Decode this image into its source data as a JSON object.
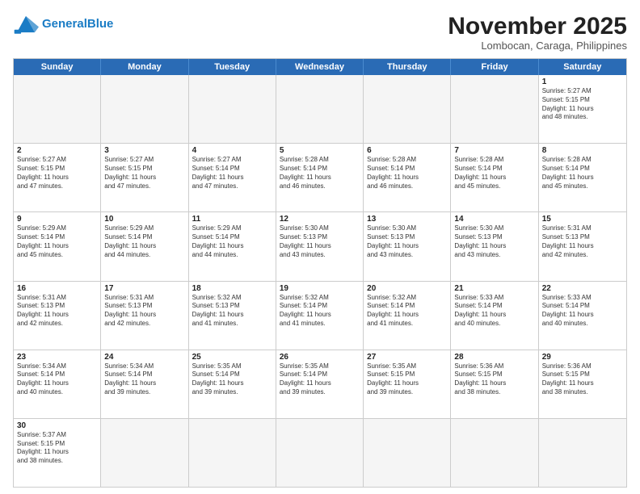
{
  "header": {
    "logo_general": "General",
    "logo_blue": "Blue",
    "month_title": "November 2025",
    "location": "Lombocan, Caraga, Philippines"
  },
  "days_of_week": [
    "Sunday",
    "Monday",
    "Tuesday",
    "Wednesday",
    "Thursday",
    "Friday",
    "Saturday"
  ],
  "rows": [
    [
      {
        "day": "",
        "text": "",
        "empty": true
      },
      {
        "day": "",
        "text": "",
        "empty": true
      },
      {
        "day": "",
        "text": "",
        "empty": true
      },
      {
        "day": "",
        "text": "",
        "empty": true
      },
      {
        "day": "",
        "text": "",
        "empty": true
      },
      {
        "day": "",
        "text": "",
        "empty": true
      },
      {
        "day": "1",
        "text": "Sunrise: 5:27 AM\nSunset: 5:15 PM\nDaylight: 11 hours\nand 48 minutes.",
        "empty": false
      }
    ],
    [
      {
        "day": "2",
        "text": "Sunrise: 5:27 AM\nSunset: 5:15 PM\nDaylight: 11 hours\nand 47 minutes.",
        "empty": false
      },
      {
        "day": "3",
        "text": "Sunrise: 5:27 AM\nSunset: 5:15 PM\nDaylight: 11 hours\nand 47 minutes.",
        "empty": false
      },
      {
        "day": "4",
        "text": "Sunrise: 5:27 AM\nSunset: 5:14 PM\nDaylight: 11 hours\nand 47 minutes.",
        "empty": false
      },
      {
        "day": "5",
        "text": "Sunrise: 5:28 AM\nSunset: 5:14 PM\nDaylight: 11 hours\nand 46 minutes.",
        "empty": false
      },
      {
        "day": "6",
        "text": "Sunrise: 5:28 AM\nSunset: 5:14 PM\nDaylight: 11 hours\nand 46 minutes.",
        "empty": false
      },
      {
        "day": "7",
        "text": "Sunrise: 5:28 AM\nSunset: 5:14 PM\nDaylight: 11 hours\nand 45 minutes.",
        "empty": false
      },
      {
        "day": "8",
        "text": "Sunrise: 5:28 AM\nSunset: 5:14 PM\nDaylight: 11 hours\nand 45 minutes.",
        "empty": false
      }
    ],
    [
      {
        "day": "9",
        "text": "Sunrise: 5:29 AM\nSunset: 5:14 PM\nDaylight: 11 hours\nand 45 minutes.",
        "empty": false
      },
      {
        "day": "10",
        "text": "Sunrise: 5:29 AM\nSunset: 5:14 PM\nDaylight: 11 hours\nand 44 minutes.",
        "empty": false
      },
      {
        "day": "11",
        "text": "Sunrise: 5:29 AM\nSunset: 5:14 PM\nDaylight: 11 hours\nand 44 minutes.",
        "empty": false
      },
      {
        "day": "12",
        "text": "Sunrise: 5:30 AM\nSunset: 5:13 PM\nDaylight: 11 hours\nand 43 minutes.",
        "empty": false
      },
      {
        "day": "13",
        "text": "Sunrise: 5:30 AM\nSunset: 5:13 PM\nDaylight: 11 hours\nand 43 minutes.",
        "empty": false
      },
      {
        "day": "14",
        "text": "Sunrise: 5:30 AM\nSunset: 5:13 PM\nDaylight: 11 hours\nand 43 minutes.",
        "empty": false
      },
      {
        "day": "15",
        "text": "Sunrise: 5:31 AM\nSunset: 5:13 PM\nDaylight: 11 hours\nand 42 minutes.",
        "empty": false
      }
    ],
    [
      {
        "day": "16",
        "text": "Sunrise: 5:31 AM\nSunset: 5:13 PM\nDaylight: 11 hours\nand 42 minutes.",
        "empty": false
      },
      {
        "day": "17",
        "text": "Sunrise: 5:31 AM\nSunset: 5:13 PM\nDaylight: 11 hours\nand 42 minutes.",
        "empty": false
      },
      {
        "day": "18",
        "text": "Sunrise: 5:32 AM\nSunset: 5:13 PM\nDaylight: 11 hours\nand 41 minutes.",
        "empty": false
      },
      {
        "day": "19",
        "text": "Sunrise: 5:32 AM\nSunset: 5:14 PM\nDaylight: 11 hours\nand 41 minutes.",
        "empty": false
      },
      {
        "day": "20",
        "text": "Sunrise: 5:32 AM\nSunset: 5:14 PM\nDaylight: 11 hours\nand 41 minutes.",
        "empty": false
      },
      {
        "day": "21",
        "text": "Sunrise: 5:33 AM\nSunset: 5:14 PM\nDaylight: 11 hours\nand 40 minutes.",
        "empty": false
      },
      {
        "day": "22",
        "text": "Sunrise: 5:33 AM\nSunset: 5:14 PM\nDaylight: 11 hours\nand 40 minutes.",
        "empty": false
      }
    ],
    [
      {
        "day": "23",
        "text": "Sunrise: 5:34 AM\nSunset: 5:14 PM\nDaylight: 11 hours\nand 40 minutes.",
        "empty": false
      },
      {
        "day": "24",
        "text": "Sunrise: 5:34 AM\nSunset: 5:14 PM\nDaylight: 11 hours\nand 39 minutes.",
        "empty": false
      },
      {
        "day": "25",
        "text": "Sunrise: 5:35 AM\nSunset: 5:14 PM\nDaylight: 11 hours\nand 39 minutes.",
        "empty": false
      },
      {
        "day": "26",
        "text": "Sunrise: 5:35 AM\nSunset: 5:14 PM\nDaylight: 11 hours\nand 39 minutes.",
        "empty": false
      },
      {
        "day": "27",
        "text": "Sunrise: 5:35 AM\nSunset: 5:15 PM\nDaylight: 11 hours\nand 39 minutes.",
        "empty": false
      },
      {
        "day": "28",
        "text": "Sunrise: 5:36 AM\nSunset: 5:15 PM\nDaylight: 11 hours\nand 38 minutes.",
        "empty": false
      },
      {
        "day": "29",
        "text": "Sunrise: 5:36 AM\nSunset: 5:15 PM\nDaylight: 11 hours\nand 38 minutes.",
        "empty": false
      }
    ],
    [
      {
        "day": "30",
        "text": "Sunrise: 5:37 AM\nSunset: 5:15 PM\nDaylight: 11 hours\nand 38 minutes.",
        "empty": false
      },
      {
        "day": "",
        "text": "",
        "empty": true
      },
      {
        "day": "",
        "text": "",
        "empty": true
      },
      {
        "day": "",
        "text": "",
        "empty": true
      },
      {
        "day": "",
        "text": "",
        "empty": true
      },
      {
        "day": "",
        "text": "",
        "empty": true
      },
      {
        "day": "",
        "text": "",
        "empty": true
      }
    ]
  ]
}
